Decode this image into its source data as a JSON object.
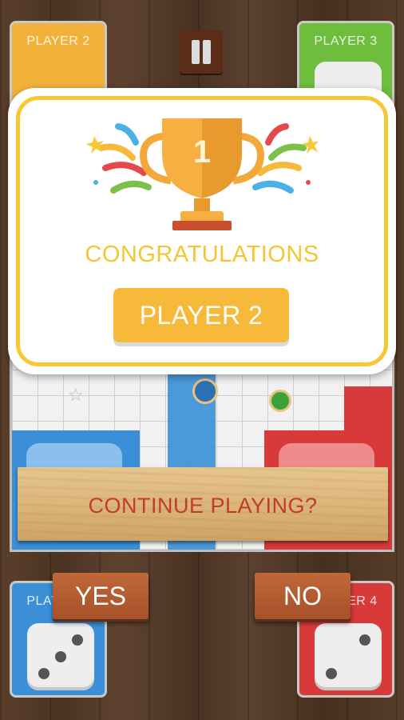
{
  "players": {
    "top_left": {
      "label": "PLAYER 2",
      "color": "#f7b93a"
    },
    "top_right": {
      "label": "PLAYER 3",
      "color": "#6cbf3b"
    },
    "bottom_left": {
      "label": "PLAYER 1",
      "color": "#3a8fd6"
    },
    "bottom_right": {
      "label": "PLAYER 4",
      "color": "#d83a3a"
    }
  },
  "win_modal": {
    "title": "CONGRATULATIONS",
    "winner": "PLAYER 2",
    "trophy_number": "1"
  },
  "continue_prompt": {
    "question": "CONTINUE PLAYING?",
    "yes_label": "YES",
    "no_label": "NO"
  },
  "colors": {
    "accent_yellow": "#f7c736",
    "prompt_red": "#c23b2b",
    "button_wood": "#b35c30"
  }
}
